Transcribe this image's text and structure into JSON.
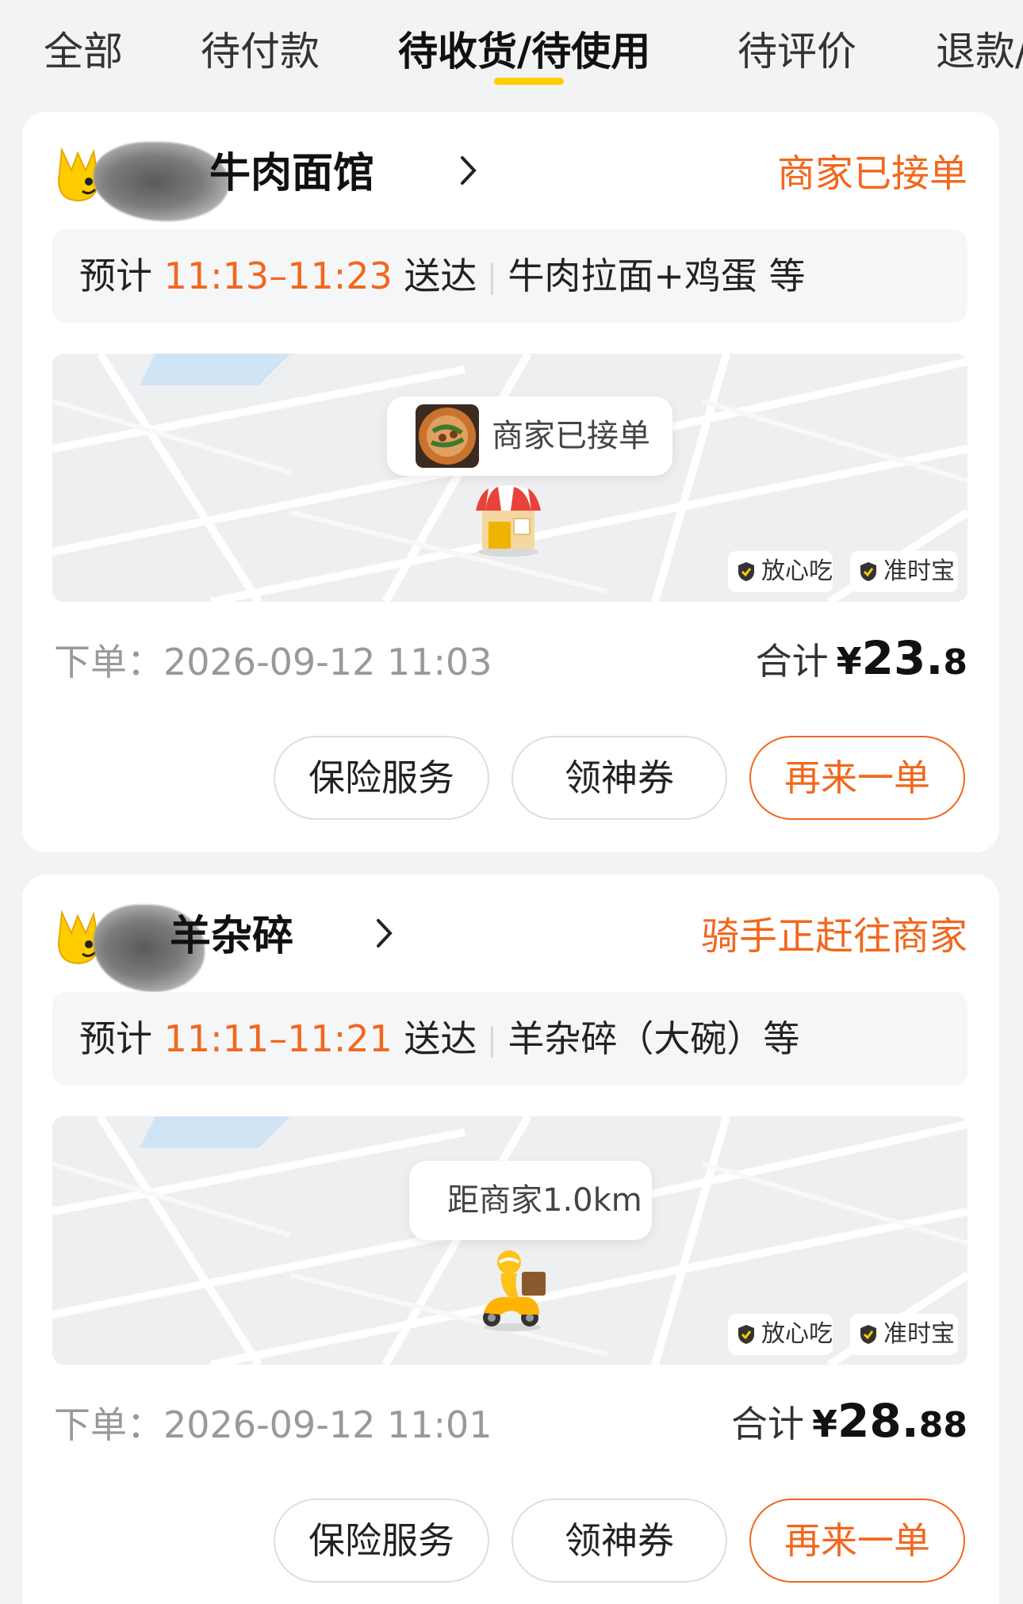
{
  "tabs": [
    {
      "label": "全部"
    },
    {
      "label": "待付款"
    },
    {
      "label": "待收货/待使用",
      "active": true
    },
    {
      "label": "待评价"
    },
    {
      "label": "退款/售后",
      "visible_text": "退款/"
    }
  ],
  "colors": {
    "accent": "#f2671d",
    "brand_yellow": "#ffcc00",
    "background": "#f2f3f5"
  },
  "orders": [
    {
      "shop_name": "牛肉面馆",
      "status": "商家已接单",
      "eta_prefix": "预计",
      "eta_time": "11:13–11:23",
      "eta_suffix": "送达",
      "items": "牛肉拉面+鸡蛋 等",
      "map_bubble": "商家已接单",
      "map_icon": "shop-icon",
      "badges": [
        "放心吃",
        "准时宝"
      ],
      "order_time": "下单：2026-09-12 11:03",
      "total_label": "合计",
      "total_currency": "¥",
      "total_int": "23.",
      "total_dec": "8",
      "buttons": {
        "insurance": "保险服务",
        "coupon": "领神券",
        "reorder": "再来一单"
      }
    },
    {
      "shop_name": "羊杂碎",
      "status": "骑手正赶往商家",
      "eta_prefix": "预计",
      "eta_time": "11:11–11:21",
      "eta_suffix": "送达",
      "items": "羊杂碎（大碗）等",
      "map_bubble": "距商家1.0km",
      "map_icon": "rider-icon",
      "badges": [
        "放心吃",
        "准时宝"
      ],
      "order_time": "下单：2026-09-12 11:01",
      "total_label": "合计",
      "total_currency": "¥",
      "total_int": "28.",
      "total_dec": "88",
      "buttons": {
        "insurance": "保险服务",
        "coupon": "领神券",
        "reorder": "再来一单"
      }
    }
  ]
}
